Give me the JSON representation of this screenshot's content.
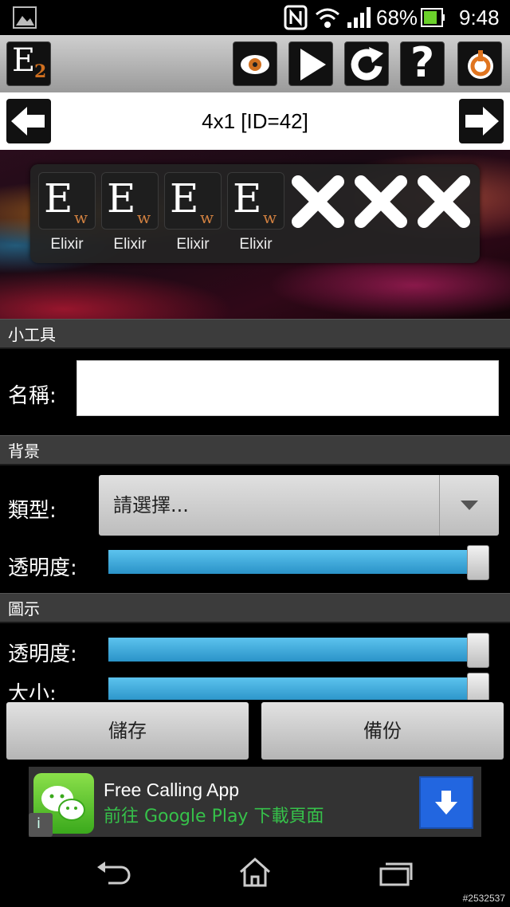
{
  "status_bar": {
    "battery": "68%",
    "time": "9:48"
  },
  "toolbar": {
    "logo_letter": "E",
    "logo_sub": "2",
    "buttons": [
      "eye-icon",
      "play-icon",
      "refresh-icon",
      "help-icon",
      "power-icon"
    ],
    "help_glyph": "?"
  },
  "title_row": {
    "title": "4x1  [ID=42]"
  },
  "preview": {
    "slots": [
      {
        "letter": "E",
        "sub": "w",
        "label": "Elixir"
      },
      {
        "letter": "E",
        "sub": "w",
        "label": "Elixir"
      },
      {
        "letter": "E",
        "sub": "w",
        "label": "Elixir"
      },
      {
        "letter": "E",
        "sub": "w",
        "label": "Elixir"
      }
    ],
    "empty_slots": 3
  },
  "section_widget": {
    "header": "小工具",
    "name_label": "名稱:",
    "name_value": ""
  },
  "section_background": {
    "header": "背景",
    "type_label": "類型:",
    "type_value": "請選擇...",
    "opacity_label": "透明度:",
    "opacity_level": 1.0
  },
  "section_icon": {
    "header": "圖示",
    "opacity_label": "透明度:",
    "opacity_level": 1.0,
    "size_label": "大小:",
    "size_level": 1.0
  },
  "actions": {
    "save": "儲存",
    "backup": "備份"
  },
  "ad": {
    "title": "Free Calling App",
    "subtitle": "前往 Google Play 下載頁面",
    "info_glyph": "i"
  },
  "watermark": "#2532537"
}
